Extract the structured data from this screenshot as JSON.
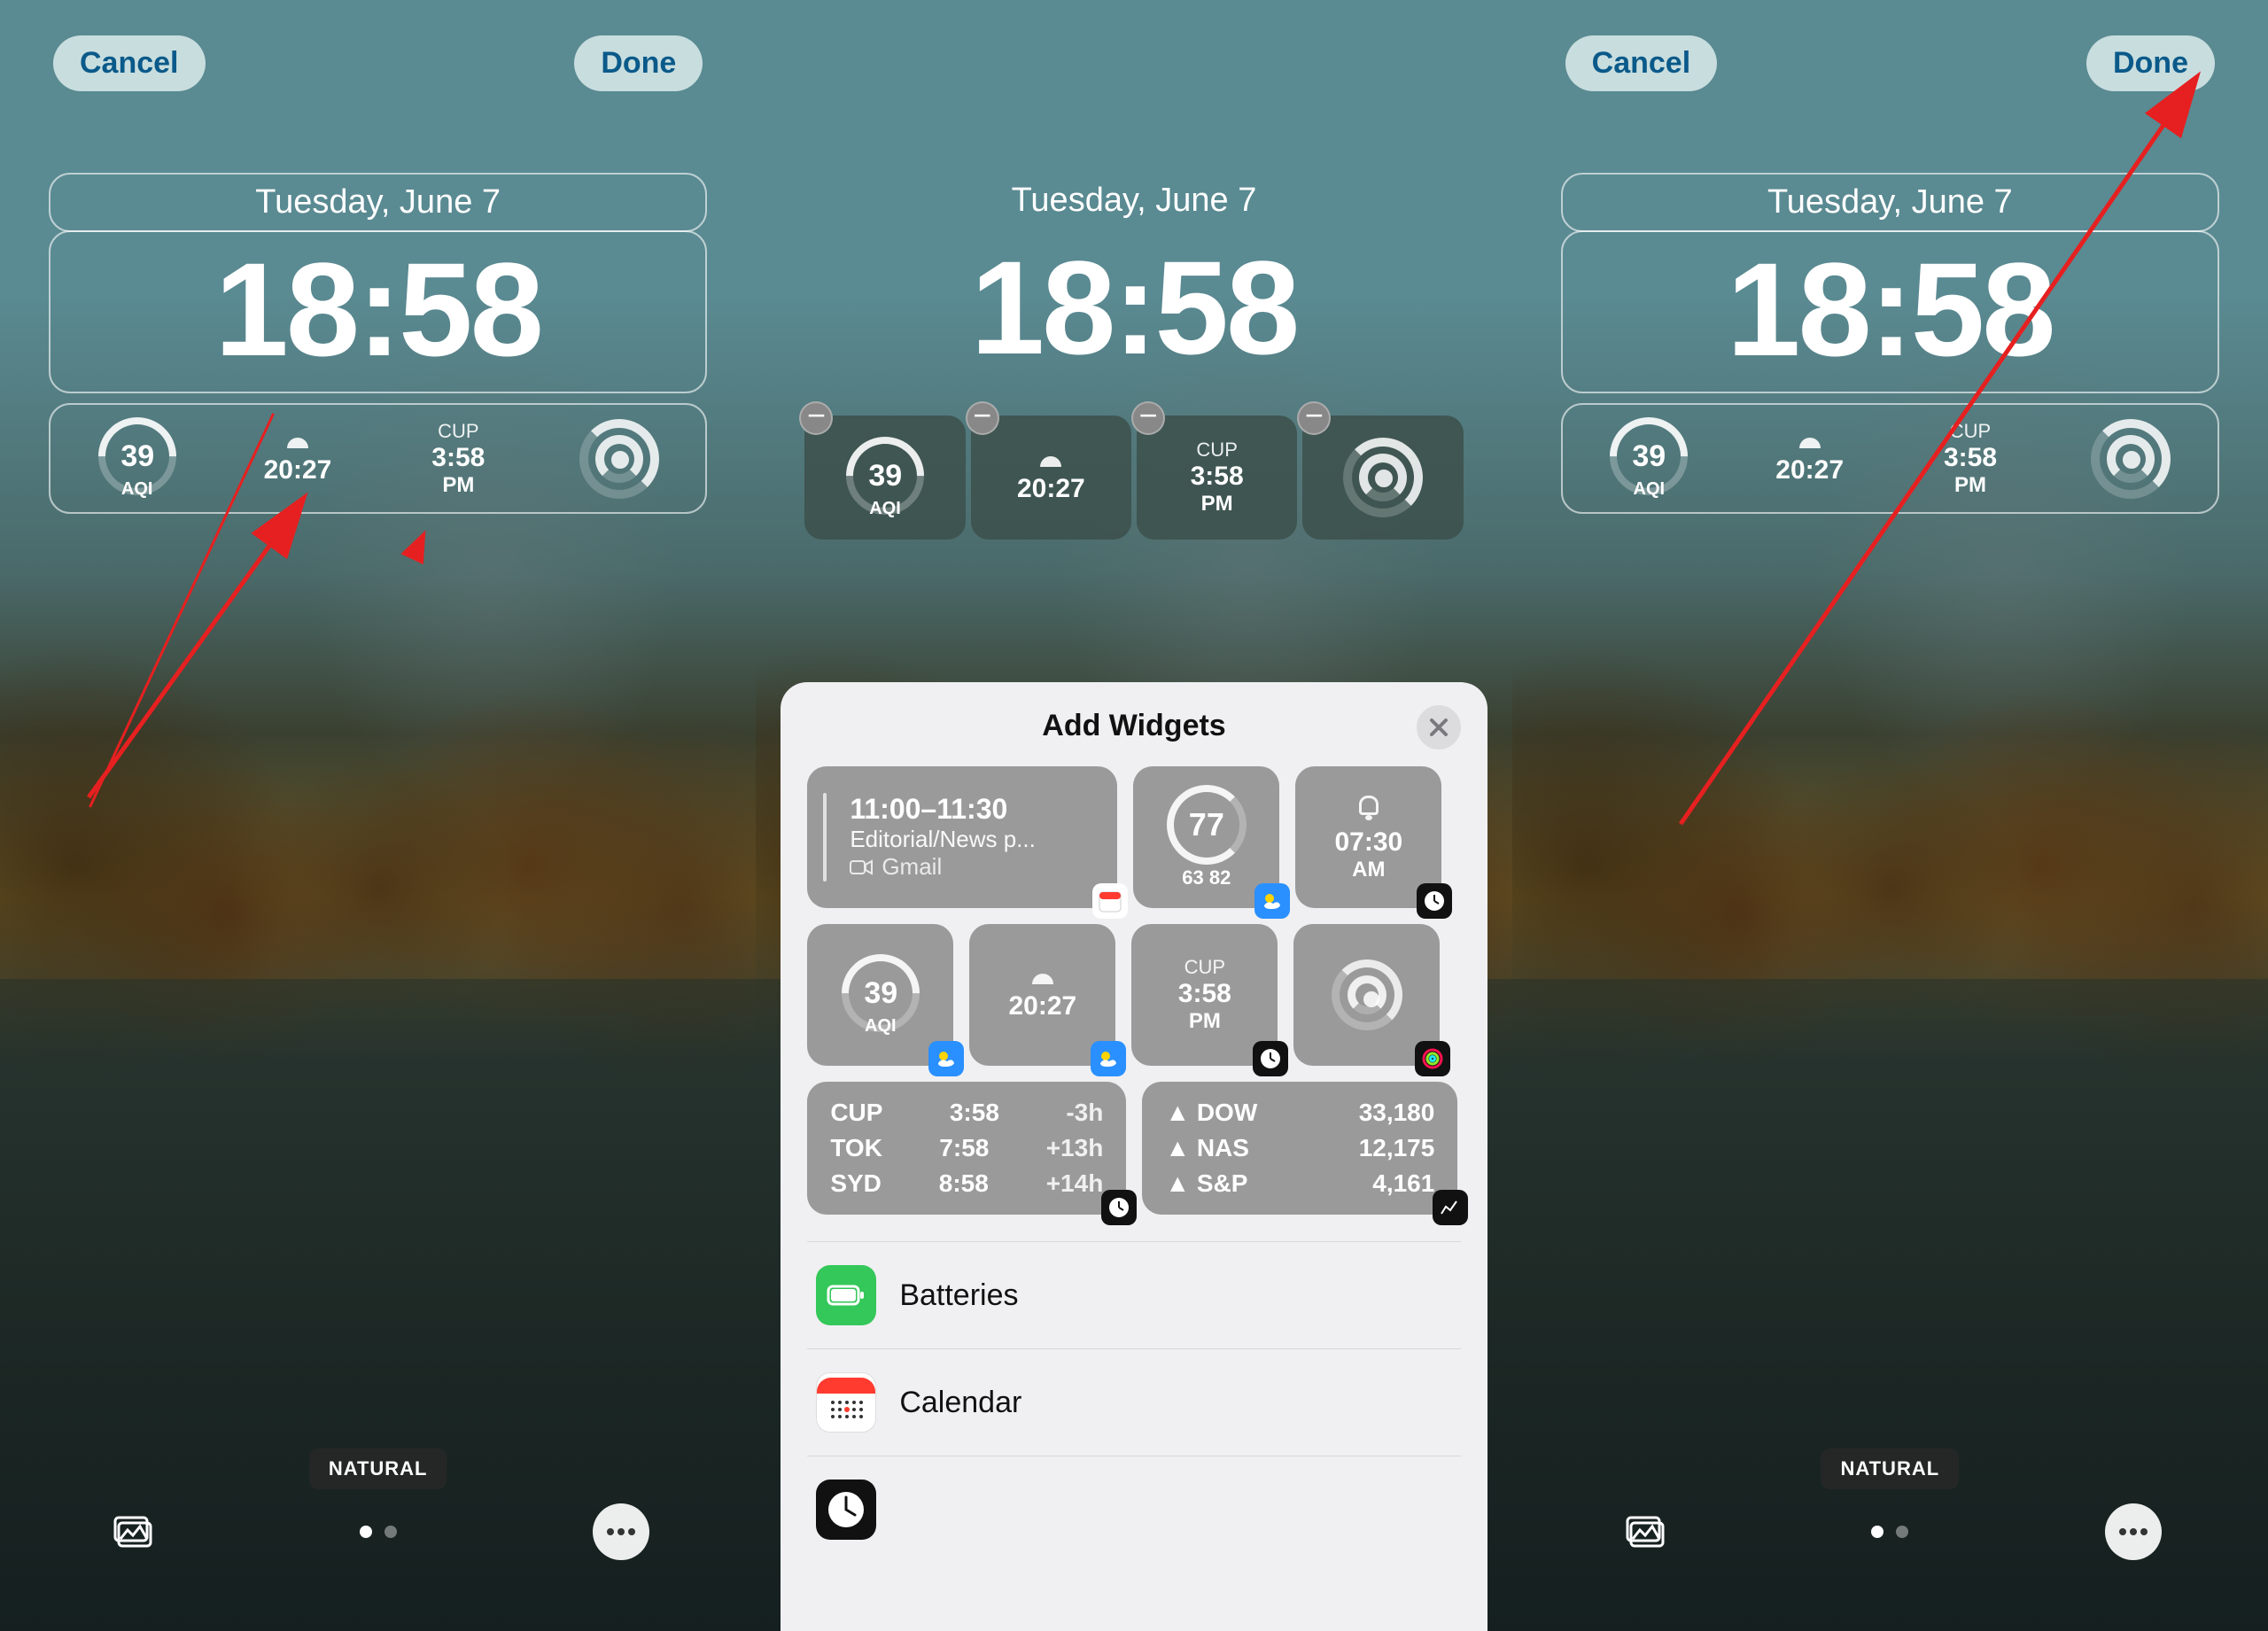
{
  "header": {
    "cancel": "Cancel",
    "done": "Done"
  },
  "lock": {
    "date": "Tuesday, June 7",
    "time": "18:58",
    "filter": "NATURAL"
  },
  "widgets": {
    "aqi": {
      "value": "39",
      "label": "AQI"
    },
    "sunset": {
      "time": "20:27"
    },
    "worldclock": {
      "city": "CUP",
      "time": "3:58",
      "ampm": "PM"
    }
  },
  "sheet": {
    "title": "Add Widgets",
    "calendar": {
      "time": "11:00–11:30",
      "title": "Editorial/News p...",
      "source": "Gmail"
    },
    "weather": {
      "temp": "77",
      "range": "63 82"
    },
    "alarm": {
      "time": "07:30",
      "ampm": "AM"
    },
    "aqi": {
      "value": "39",
      "label": "AQI"
    },
    "sunset": {
      "time": "20:27"
    },
    "worldclock": {
      "city": "CUP",
      "time": "3:58",
      "ampm": "PM"
    },
    "world_cities": [
      {
        "code": "CUP",
        "time": "3:58",
        "offset": "-3h"
      },
      {
        "code": "TOK",
        "time": "7:58",
        "offset": "+13h"
      },
      {
        "code": "SYD",
        "time": "8:58",
        "offset": "+14h"
      }
    ],
    "stocks": [
      {
        "sym": "DOW",
        "val": "33,180"
      },
      {
        "sym": "NAS",
        "val": "12,175"
      },
      {
        "sym": "S&P",
        "val": "4,161"
      }
    ],
    "apps": {
      "batteries": "Batteries",
      "calendar": "Calendar"
    }
  }
}
